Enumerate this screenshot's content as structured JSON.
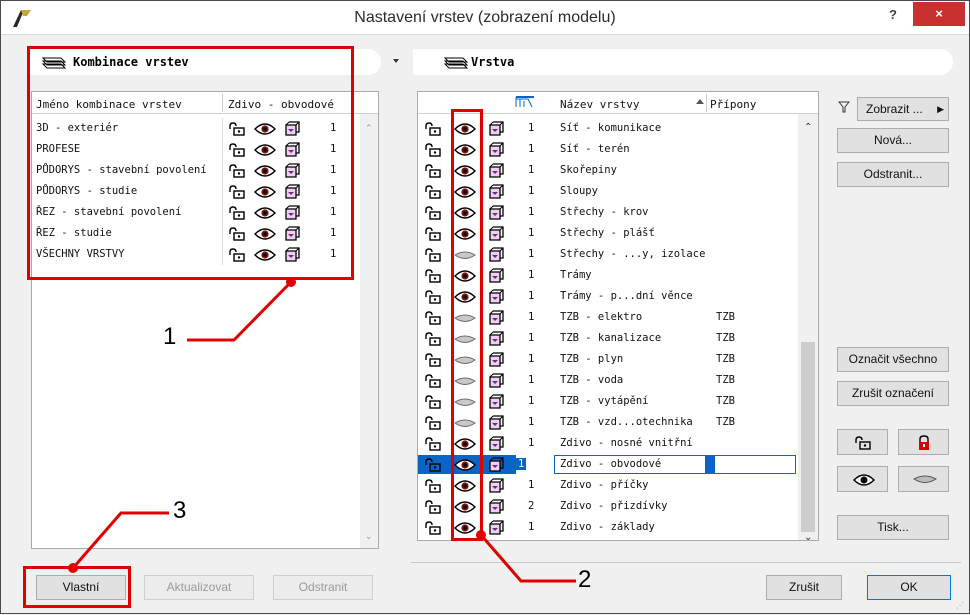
{
  "window": {
    "title": "Nastavení vrstev (zobrazení modelu)",
    "help": "?",
    "close": "×"
  },
  "left": {
    "header": "Kombinace vrstev",
    "col_name": "Jméno kombinace vrstev",
    "col_zdivo": "Zdivo - obvodové",
    "rows": [
      {
        "name": "3D - exteriér",
        "num": "1"
      },
      {
        "name": "PROFESE",
        "num": "1"
      },
      {
        "name": "PŮDORYS - stavební povolení",
        "num": "1"
      },
      {
        "name": "PŮDORYS - studie",
        "num": "1"
      },
      {
        "name": "ŘEZ - stavební povolení",
        "num": "1"
      },
      {
        "name": "ŘEZ - studie",
        "num": "1"
      },
      {
        "name": "VŠECHNY VRSTVY",
        "num": "1"
      }
    ],
    "buttons": {
      "vlastni": "Vlastní",
      "aktualizovat": "Aktualizovat",
      "odstranit": "Odstranit"
    }
  },
  "right": {
    "header": "Vrstva",
    "col_name": "Název vrstvy",
    "col_ext": "Přípony",
    "rows": [
      {
        "num": "1",
        "name": "Síť - komunikace",
        "ext": "",
        "visible": true
      },
      {
        "num": "1",
        "name": "Síť - terén",
        "ext": "",
        "visible": true
      },
      {
        "num": "1",
        "name": "Skořepiny",
        "ext": "",
        "visible": true
      },
      {
        "num": "1",
        "name": "Sloupy",
        "ext": "",
        "visible": true
      },
      {
        "num": "1",
        "name": "Střechy - krov",
        "ext": "",
        "visible": true
      },
      {
        "num": "1",
        "name": "Střechy - plášť",
        "ext": "",
        "visible": true
      },
      {
        "num": "1",
        "name": "Střechy - ...y, izolace",
        "ext": "",
        "visible": false
      },
      {
        "num": "1",
        "name": "Trámy",
        "ext": "",
        "visible": true
      },
      {
        "num": "1",
        "name": "Trámy - p...dní věnce",
        "ext": "",
        "visible": true
      },
      {
        "num": "1",
        "name": "TZB - elektro",
        "ext": "TZB",
        "visible": false
      },
      {
        "num": "1",
        "name": "TZB - kanalizace",
        "ext": "TZB",
        "visible": false
      },
      {
        "num": "1",
        "name": "TZB - plyn",
        "ext": "TZB",
        "visible": false
      },
      {
        "num": "1",
        "name": "TZB - voda",
        "ext": "TZB",
        "visible": false
      },
      {
        "num": "1",
        "name": "TZB - vytápění",
        "ext": "TZB",
        "visible": false
      },
      {
        "num": "1",
        "name": "TZB - vzd...otechnika",
        "ext": "TZB",
        "visible": false
      },
      {
        "num": "1",
        "name": "Zdivo - nosné vnitřní",
        "ext": "",
        "visible": true
      },
      {
        "num": "1",
        "name": "Zdivo - obvodové",
        "ext": "",
        "visible": true,
        "selected": true
      },
      {
        "num": "1",
        "name": "Zdivo - příčky",
        "ext": "",
        "visible": true
      },
      {
        "num": "2",
        "name": "Zdivo - přizdívky",
        "ext": "",
        "visible": true
      },
      {
        "num": "1",
        "name": "Zdivo - základy",
        "ext": "",
        "visible": true
      }
    ]
  },
  "side_buttons": {
    "zobrazit": "Zobrazit ...",
    "nova": "Nová...",
    "odstranit": "Odstranit...",
    "oznacit": "Označit všechno",
    "zrusit_oznaceni": "Zrušit označení",
    "tisk": "Tisk..."
  },
  "bottom": {
    "zrusit": "Zrušit",
    "ok": "OK"
  },
  "annotations": {
    "a1": "1",
    "a2": "2",
    "a3": "3"
  },
  "colors": {
    "annotation": "#e00000",
    "selection": "#0a64c8",
    "close": "#c7312f"
  }
}
